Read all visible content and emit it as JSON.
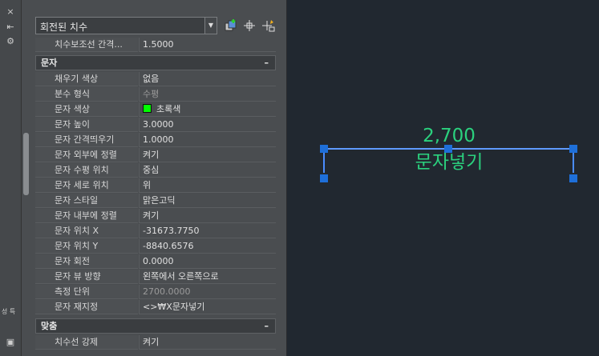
{
  "palette": {
    "dropdown": {
      "value": "회전된 치수"
    },
    "icons": {
      "close": "×",
      "pin": "⇤",
      "settings": "⚙",
      "properties_tab": "특성",
      "bottom": "▣"
    },
    "top_row": {
      "label": "치수보조선 간격...",
      "value": "1.5000"
    },
    "sections": [
      {
        "title": "문자",
        "collapse": "–"
      },
      {
        "title": "맞춤",
        "collapse": "–"
      }
    ],
    "text_rows": [
      {
        "label": "채우기 색상",
        "value": "없음"
      },
      {
        "label": "분수 형식",
        "value": "수평"
      },
      {
        "label": "문자 색상",
        "value": "초록색"
      },
      {
        "label": "문자 높이",
        "value": "3.0000"
      },
      {
        "label": "문자 간격띄우기",
        "value": "1.0000"
      },
      {
        "label": "문자 외부에 정렬",
        "value": "켜기"
      },
      {
        "label": "문자 수평 위치",
        "value": "중심"
      },
      {
        "label": "문자 세로 위치",
        "value": "위"
      },
      {
        "label": "문자 스타일",
        "value": "맑은고딕"
      },
      {
        "label": "문자 내부에 정렬",
        "value": "켜기"
      },
      {
        "label": "문자 위치 X",
        "value": "-31673.7750"
      },
      {
        "label": "문자 위치 Y",
        "value": "-8840.6576"
      },
      {
        "label": "문자 회전",
        "value": "0.0000"
      },
      {
        "label": "문자 뷰 방향",
        "value": "왼쪽에서 오른쪽으로"
      },
      {
        "label": "측정 단위",
        "value": "2700.0000"
      },
      {
        "label": "문자 재지정",
        "value": "<>₩X문자넣기"
      }
    ],
    "fit_rows": [
      {
        "label": "치수선 강제",
        "value": "켜기"
      }
    ]
  },
  "drawing": {
    "dimension_value": "2,700",
    "dimension_text": "문자넣기",
    "colors": {
      "dim_line": "#4a8cff",
      "grip": "#1e6fd9",
      "text": "#2bd17e",
      "background": "#212830"
    }
  }
}
